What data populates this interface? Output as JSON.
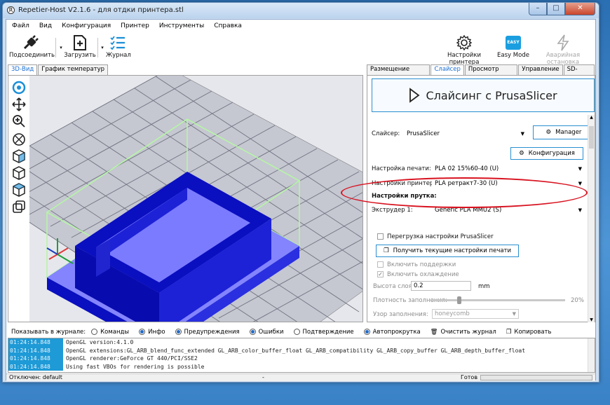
{
  "window": {
    "title": "Repetier-Host V2.1.6 - для отдки принтера.stl",
    "app_icon": "R"
  },
  "menu": [
    "Файл",
    "Вид",
    "Конфигурация",
    "Принтер",
    "Инструменты",
    "Справка"
  ],
  "toolbar": {
    "connect_label": "Подсоединить",
    "load_label": "Загрузить",
    "log_label": "Журнал",
    "printer_settings_label": "Настройки принтера",
    "easy_mode_label": "Easy Mode",
    "easy_badge": "EASY",
    "emergency_stop_label": "Аварийная остановка"
  },
  "left_tabs": [
    "3D-Вид",
    "График температур"
  ],
  "right_tabs": [
    "Размещение объекта",
    "Слайсер",
    "Просмотр печати",
    "Управление",
    "SD-карта"
  ],
  "slicer": {
    "slice_button": "Слайсинг с PrusaSlicer",
    "slicer_label": "Слайсер:",
    "slicer_value": "PrusaSlicer",
    "manager_button": "Manager",
    "config_button": "Конфигурация",
    "print_settings_label": "Настройка печати:",
    "print_settings_value": "PLA 02 15%60-40 (U)",
    "printer_settings_label": "Настройки принтера:",
    "printer_settings_value": "PLA ретракт7-30 (U)",
    "filament_header": "Настройки прутка:",
    "extruder_label": "Экструдер 1:",
    "extruder_value": "Generic PLA MMU2 (S)",
    "override_label": "Перегрузка настройки PrusaSlicer",
    "get_current_button": "Получить текущие настройки печати",
    "support_label": "Включить поддержки",
    "cooling_label": "Включить охлаждение",
    "layer_height_label": "Высота слоя:",
    "layer_height_value": "0.2",
    "layer_height_unit": "mm",
    "infill_density_label": "Плотность заполнения:",
    "infill_density_value": "20%",
    "infill_density_fraction": 0.2,
    "infill_pattern_label": "Узор заполнения:",
    "infill_pattern_value": "honeycomb"
  },
  "log": {
    "show_label": "Показывать в журнале:",
    "options": [
      {
        "label": "Команды",
        "on": false
      },
      {
        "label": "Инфо",
        "on": true
      },
      {
        "label": "Предупреждения",
        "on": true
      },
      {
        "label": "Ошибки",
        "on": true
      },
      {
        "label": "Подтверждение",
        "on": false
      },
      {
        "label": "Автопрокрутка",
        "on": true
      }
    ],
    "clear_label": "Очистить журнал",
    "copy_label": "Копировать",
    "lines": [
      {
        "time": "01:24:14.848",
        "msg": "OpenGL version:4.1.0"
      },
      {
        "time": "01:24:14.848",
        "msg": "OpenGL extensions:GL_ARB_blend_func_extended GL_ARB_color_buffer_float GL_ARB_compatibility GL_ARB_copy_buffer GL_ARB_depth_buffer_float"
      },
      {
        "time": "01:24:14.848",
        "msg": "OpenGL renderer:GeForce GT 440/PCI/SSE2"
      },
      {
        "time": "01:24:14.848",
        "msg": "Using fast VBOs for rendering is possible"
      }
    ]
  },
  "status": {
    "left": "Отключен: default",
    "middle": "-",
    "right": "Готов"
  },
  "colors": {
    "accent": "#1a6ed3",
    "object_dark": "#0a0fc0",
    "object_light": "#8484ff",
    "bbox": "#b6f5a6",
    "annotation": "#d8121f"
  }
}
